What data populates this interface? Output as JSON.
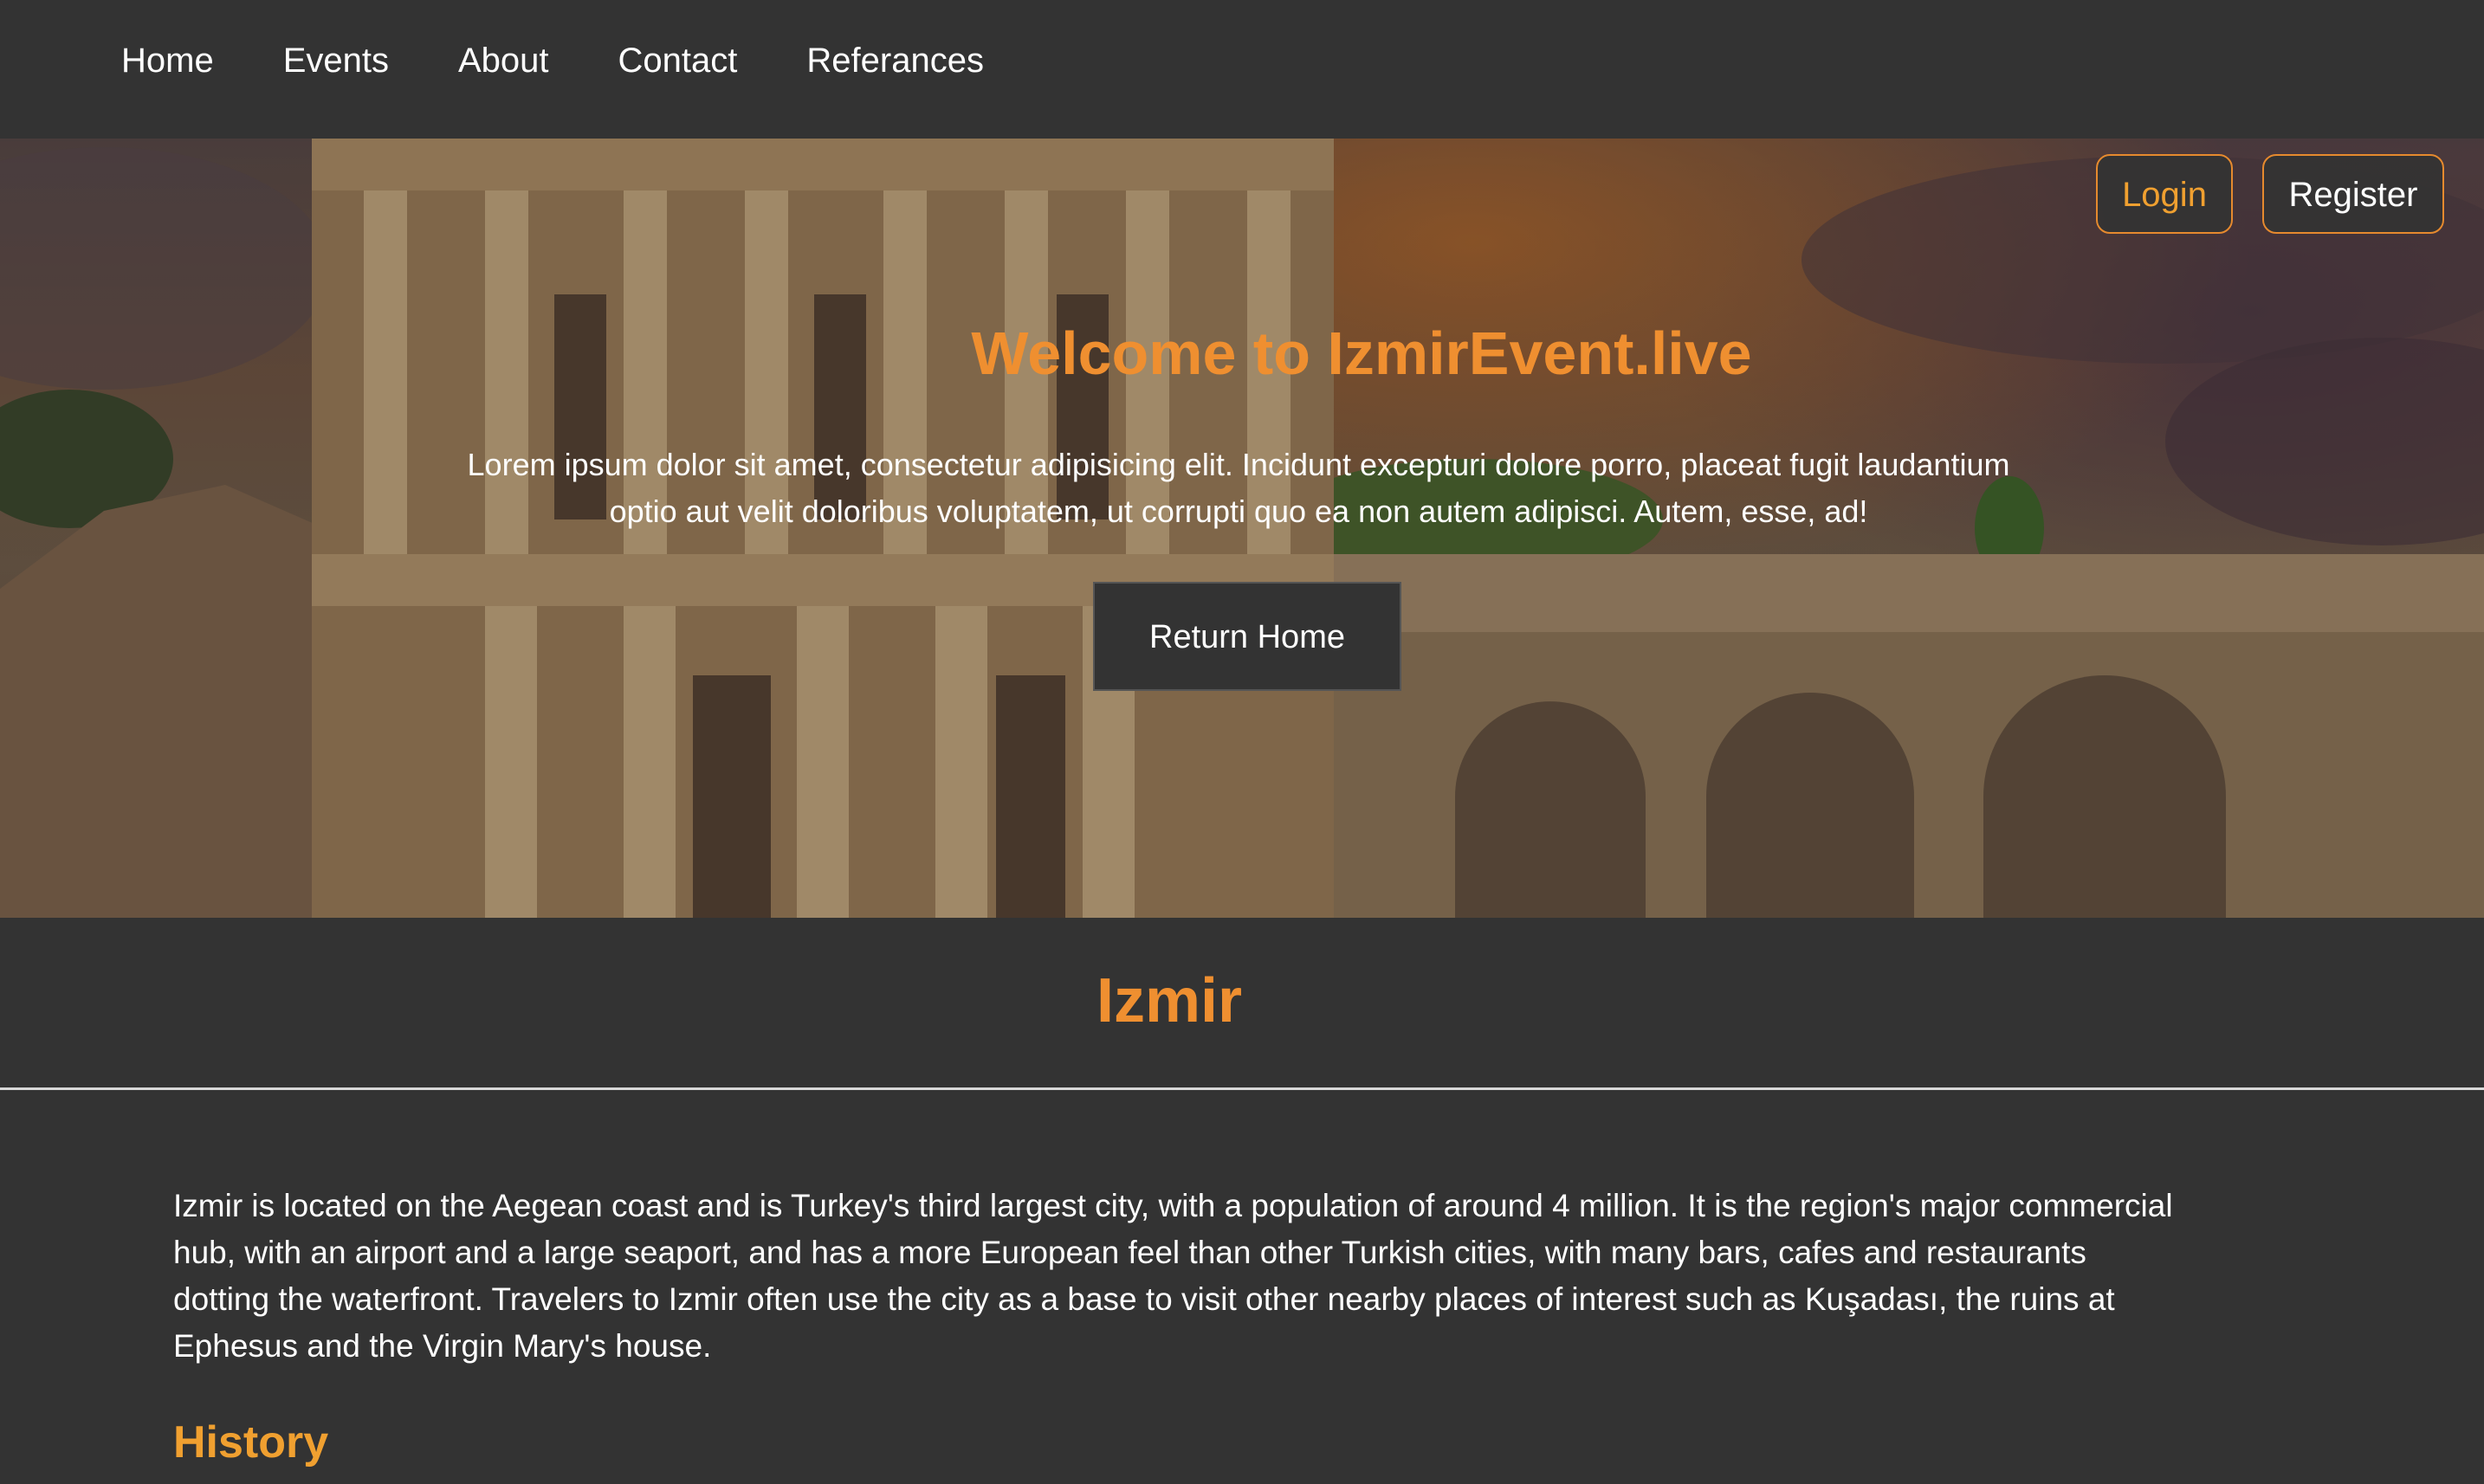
{
  "nav": {
    "items": [
      {
        "label": "Home"
      },
      {
        "label": "Events"
      },
      {
        "label": "About"
      },
      {
        "label": "Contact"
      },
      {
        "label": "Referances"
      }
    ]
  },
  "auth": {
    "login_label": "Login",
    "register_label": "Register"
  },
  "hero": {
    "title": "Welcome to IzmirEvent.live",
    "text": "Lorem ipsum dolor sit amet, consectetur adipisicing elit. Incidunt excepturi dolore porro, placeat fugit laudantium optio aut velit doloribus voluptatem, ut corrupti quo ea non autem adipisci. Autem, esse, ad!",
    "button_label": "Return Home"
  },
  "content": {
    "city_title": "Izmir",
    "intro": "Izmir is located on the Aegean coast and is Turkey's third largest city, with a population of around 4 million. It is the region's major commercial hub, with an airport and a large seaport, and has a more European feel than other Turkish cities, with many bars, cafes and restaurants dotting the waterfront. Travelers to Izmir often use the city as a base to visit other nearby places of interest such as Kuşadası, the ruins at Ephesus and the Virgin Mary's house.",
    "history_heading": "History"
  },
  "colors": {
    "background": "#333333",
    "accent": "#ef8f30",
    "text": "#ffffff"
  }
}
